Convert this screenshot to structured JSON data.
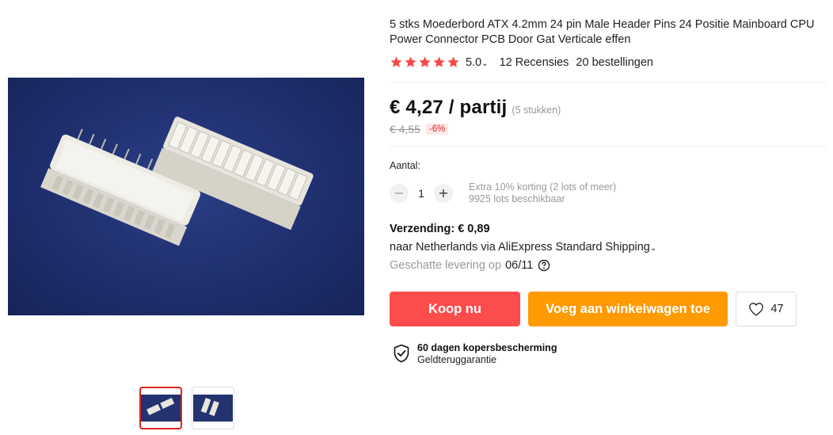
{
  "product": {
    "title": "5 stks Moederbord ATX 4.2mm 24 pin Male Header Pins 24 Positie Mainboard CPU Power Connector PCB Door Gat Verticale effen",
    "rating": {
      "stars": 5,
      "score": "5.0",
      "reviews": "12 Recensies",
      "orders": "20 bestellingen"
    },
    "price": "€ 4,27 / partij",
    "price_note": "(5 stukken)",
    "original_price": "€ 4,55",
    "discount": "-6%"
  },
  "quantity": {
    "label": "Aantal:",
    "value": "1",
    "minus": "−",
    "plus": "+",
    "note1": "Extra 10% korting (2 lots of meer)",
    "note2": "9925 lots beschikbaar"
  },
  "shipping": {
    "title": "Verzending: € 0,89",
    "route": "naar Netherlands via AliExpress Standard Shipping",
    "estimate_label": "Geschatte levering op",
    "estimate_date": "06/11"
  },
  "actions": {
    "buy": "Koop nu",
    "cart": "Voeg aan winkelwagen toe",
    "wish_count": "47"
  },
  "protection": {
    "title": "60 dagen kopersbescherming",
    "subtitle": "Geldteruggarantie"
  },
  "colors": {
    "star": "#f74747",
    "buy": "#fd4c4c",
    "cart": "#ff9a00",
    "thumb_active": "#e12424"
  },
  "icons": [
    "star-icon",
    "chevron-down-icon",
    "help-icon",
    "heart-icon",
    "shield-check-icon"
  ]
}
